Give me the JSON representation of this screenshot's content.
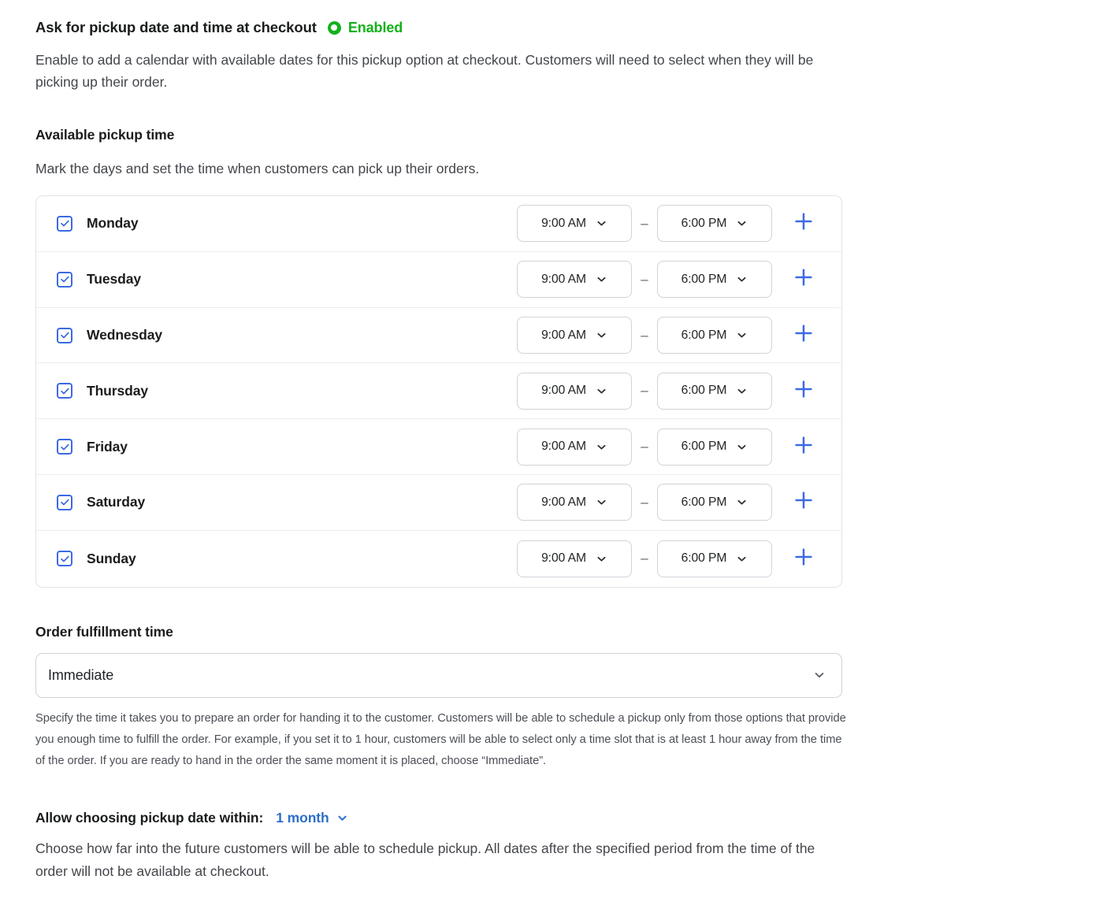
{
  "header": {
    "title": "Ask for pickup date and time at checkout",
    "status_icon": "filled-circle-ring-icon",
    "status_label": "Enabled",
    "status_color": "#14b11b",
    "description": "Enable to add a calendar with available dates for this pickup option at checkout. Customers will need to select when they will be picking up their order."
  },
  "available_pickup_time": {
    "heading": "Available pickup time",
    "description": "Mark the days and set the time when customers can pick up their orders.",
    "range_separator": "–",
    "add_icon": "plus-icon",
    "checkbox_icon": "check-icon",
    "chevron_icon": "chevron-down-icon",
    "rows": [
      {
        "day": "Monday",
        "checked": true,
        "start": "9:00 AM",
        "end": "6:00 PM"
      },
      {
        "day": "Tuesday",
        "checked": true,
        "start": "9:00 AM",
        "end": "6:00 PM"
      },
      {
        "day": "Wednesday",
        "checked": true,
        "start": "9:00 AM",
        "end": "6:00 PM"
      },
      {
        "day": "Thursday",
        "checked": true,
        "start": "9:00 AM",
        "end": "6:00 PM"
      },
      {
        "day": "Friday",
        "checked": true,
        "start": "9:00 AM",
        "end": "6:00 PM"
      },
      {
        "day": "Saturday",
        "checked": true,
        "start": "9:00 AM",
        "end": "6:00 PM"
      },
      {
        "day": "Sunday",
        "checked": true,
        "start": "9:00 AM",
        "end": "6:00 PM"
      }
    ]
  },
  "order_fulfillment": {
    "heading": "Order fulfillment time",
    "selected_value": "Immediate",
    "chevron_icon": "chevron-down-icon",
    "helper": "Specify the time it takes you to prepare an order for handing it to the customer. Customers will be able to schedule a pickup only from those options that provide you enough time to fulfill the order. For example, if you set it to 1 hour, customers will be able to select only a time slot that is at least 1 hour away from the time of the order. If you are ready to hand in the order the same moment it is placed, choose “Immediate”."
  },
  "allow_choosing": {
    "label": "Allow choosing pickup date within:",
    "selected_value": "1 month",
    "chevron_icon": "chevron-down-icon",
    "link_color": "#2c6ecb",
    "description": "Choose how far into the future customers will be able to schedule pickup. All dates after the specified period from the time of the order will not be available at checkout."
  },
  "theme": {
    "accent_blue": "#3b6ae3",
    "enabled_green": "#14b11b",
    "link_blue": "#2c6ecb",
    "border": "#cfd3d8"
  }
}
